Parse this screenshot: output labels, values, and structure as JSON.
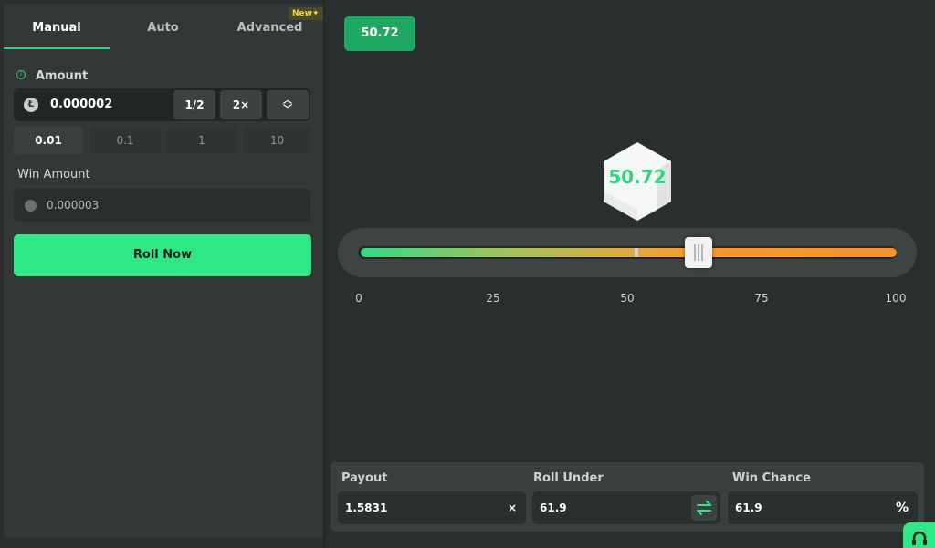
{
  "tabs": [
    {
      "label": "Manual",
      "active": true
    },
    {
      "label": "Auto",
      "active": false
    },
    {
      "label": "Advanced",
      "active": false
    }
  ],
  "new_badge": "New",
  "amount": {
    "label": "Amount",
    "value": "0.000002",
    "half_label": "1/2",
    "double_label": "2×",
    "coin_icon": "litecoin-icon"
  },
  "presets": [
    {
      "label": "0.01",
      "active": true
    },
    {
      "label": "0.1",
      "active": false
    },
    {
      "label": "1",
      "active": false
    },
    {
      "label": "10",
      "active": false
    }
  ],
  "win_amount": {
    "label": "Win Amount",
    "value": "0.000003"
  },
  "roll_button": "Roll Now",
  "result": {
    "value": "50.72"
  },
  "slider": {
    "ticks": [
      "0",
      "25",
      "50",
      "75",
      "100"
    ],
    "min": 0,
    "max": 100,
    "value": 61.9,
    "result": 50.72
  },
  "payout": {
    "label": "Payout",
    "value": "1.5831",
    "suffix": "×"
  },
  "roll_under": {
    "label": "Roll Under",
    "value": "61.9"
  },
  "win_chance": {
    "label": "Win Chance",
    "value": "61.9",
    "suffix": "%"
  },
  "colors": {
    "accent": "#2ee886",
    "background": "#2b2e2e",
    "panel": "#333737",
    "slider_low": "#33d985",
    "slider_high": "#f89a29"
  }
}
